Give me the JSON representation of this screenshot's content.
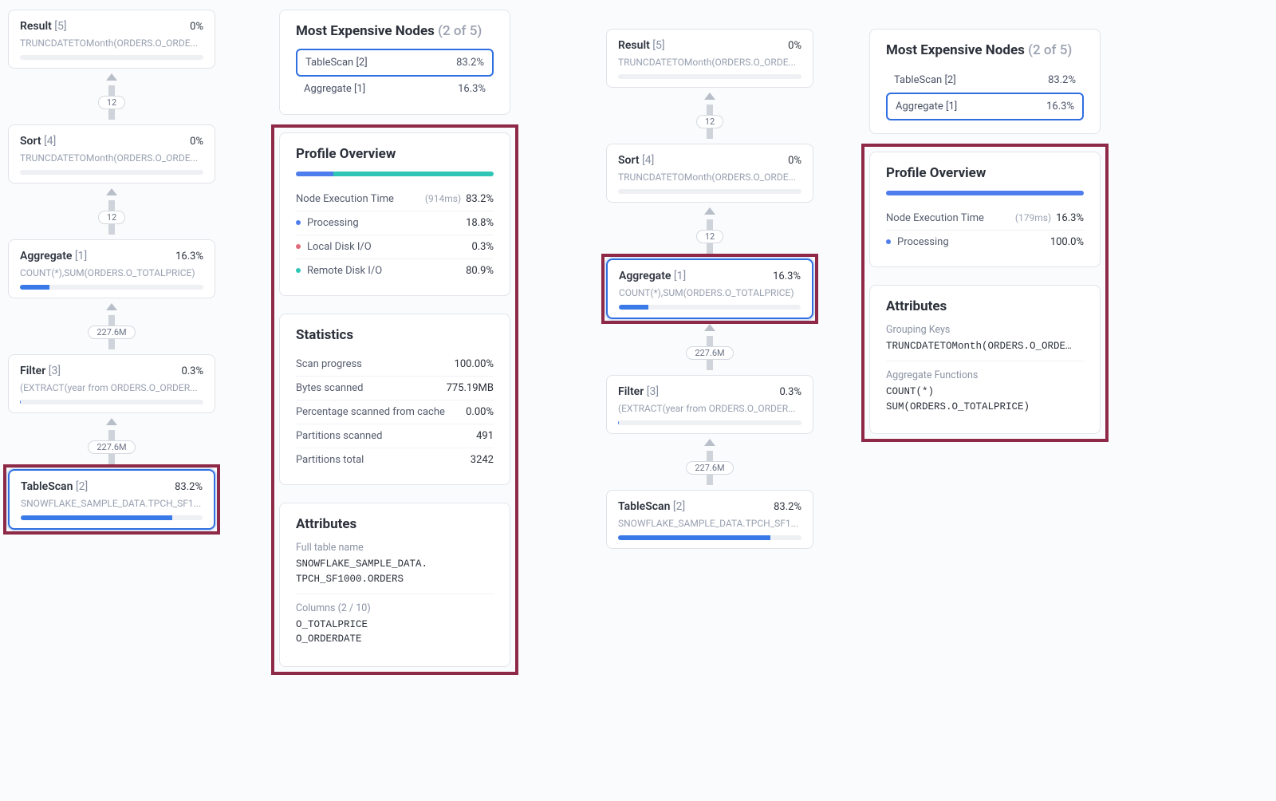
{
  "left": {
    "nodes": [
      {
        "name": "Result",
        "idx": "[5]",
        "pct": "0%",
        "sub": "TRUNCDATETOMonth(ORDERS.O_ORDE...",
        "barPct": 0,
        "selected": false
      },
      {
        "name": "Sort",
        "idx": "[4]",
        "pct": "0%",
        "sub": "TRUNCDATETOMonth(ORDERS.O_ORDE...",
        "barPct": 0,
        "selected": false
      },
      {
        "name": "Aggregate",
        "idx": "[1]",
        "pct": "16.3%",
        "sub": "COUNT(*),SUM(ORDERS.O_TOTALPRICE)",
        "barPct": 16.3,
        "selected": false
      },
      {
        "name": "Filter",
        "idx": "[3]",
        "pct": "0.3%",
        "sub": "(EXTRACT(year from ORDERS.O_ORDER...",
        "barPct": 0.3,
        "selected": false
      },
      {
        "name": "TableScan",
        "idx": "[2]",
        "pct": "83.2%",
        "sub": "SNOWFLAKE_SAMPLE_DATA.TPCH_SF1...",
        "barPct": 83.2,
        "selected": true
      }
    ],
    "edges": [
      "12",
      "12",
      "227.6M",
      "227.6M"
    ]
  },
  "right": {
    "nodes": [
      {
        "name": "Result",
        "idx": "[5]",
        "pct": "0%",
        "sub": "TRUNCDATETOMonth(ORDERS.O_ORDE...",
        "barPct": 0,
        "selected": false
      },
      {
        "name": "Sort",
        "idx": "[4]",
        "pct": "0%",
        "sub": "TRUNCDATETOMonth(ORDERS.O_ORDE...",
        "barPct": 0,
        "selected": false
      },
      {
        "name": "Aggregate",
        "idx": "[1]",
        "pct": "16.3%",
        "sub": "COUNT(*),SUM(ORDERS.O_TOTALPRICE)",
        "barPct": 16.3,
        "selected": true
      },
      {
        "name": "Filter",
        "idx": "[3]",
        "pct": "0.3%",
        "sub": "(EXTRACT(year from ORDERS.O_ORDER...",
        "barPct": 0.3,
        "selected": false
      },
      {
        "name": "TableScan",
        "idx": "[2]",
        "pct": "83.2%",
        "sub": "SNOWFLAKE_SAMPLE_DATA.TPCH_SF1...",
        "barPct": 83.2,
        "selected": false
      }
    ],
    "edges": [
      "12",
      "12",
      "227.6M",
      "227.6M"
    ]
  },
  "panelA": {
    "me": {
      "title": "Most Expensive Nodes",
      "count": "(2 of 5)",
      "rows": [
        {
          "label": "TableScan [2]",
          "pct": "83.2%",
          "selected": true
        },
        {
          "label": "Aggregate [1]",
          "pct": "16.3%",
          "selected": false
        }
      ]
    },
    "po": {
      "title": "Profile Overview",
      "segs": [
        {
          "w": 18.8,
          "c": "#4f7ded"
        },
        {
          "w": 0.3,
          "c": "#e06a7a"
        },
        {
          "w": 80.9,
          "c": "#2fc6b6"
        }
      ],
      "exec_label": "Node Execution Time",
      "exec_ms": "(914ms)",
      "exec_pct": "83.2%",
      "lines": [
        {
          "dot": "#4f7ded",
          "label": "Processing",
          "val": "18.8%"
        },
        {
          "dot": "#e06a7a",
          "label": "Local Disk I/O",
          "val": "0.3%"
        },
        {
          "dot": "#2fc6b6",
          "label": "Remote Disk I/O",
          "val": "80.9%"
        }
      ]
    },
    "stats": {
      "title": "Statistics",
      "rows": [
        {
          "label": "Scan progress",
          "val": "100.00%"
        },
        {
          "label": "Bytes scanned",
          "val": "775.19MB"
        },
        {
          "label": "Percentage scanned from cache",
          "val": "0.00%"
        },
        {
          "label": "Partitions scanned",
          "val": "491"
        },
        {
          "label": "Partitions total",
          "val": "3242"
        }
      ]
    },
    "attrs": {
      "title": "Attributes",
      "items": [
        {
          "label": "Full table name",
          "val": "SNOWFLAKE_SAMPLE_DATA.\nTPCH_SF1000.ORDERS"
        },
        {
          "label": "Columns (2 / 10)",
          "val": "O_TOTALPRICE\nO_ORDERDATE"
        }
      ]
    }
  },
  "panelB": {
    "me": {
      "title": "Most Expensive Nodes",
      "count": "(2 of 5)",
      "rows": [
        {
          "label": "TableScan [2]",
          "pct": "83.2%",
          "selected": false
        },
        {
          "label": "Aggregate [1]",
          "pct": "16.3%",
          "selected": true
        }
      ]
    },
    "po": {
      "title": "Profile Overview",
      "segs": [
        {
          "w": 100,
          "c": "#4f7ded"
        }
      ],
      "exec_label": "Node Execution Time",
      "exec_ms": "(179ms)",
      "exec_pct": "16.3%",
      "lines": [
        {
          "dot": "#4f7ded",
          "label": "Processing",
          "val": "100.0%"
        }
      ]
    },
    "attrs": {
      "title": "Attributes",
      "items": [
        {
          "label": "Grouping Keys",
          "val": "TRUNCDATETOMonth(ORDERS.O_ORDE…"
        },
        {
          "label": "Aggregate Functions",
          "val": "COUNT(*)\nSUM(ORDERS.O_TOTALPRICE)"
        }
      ]
    }
  }
}
